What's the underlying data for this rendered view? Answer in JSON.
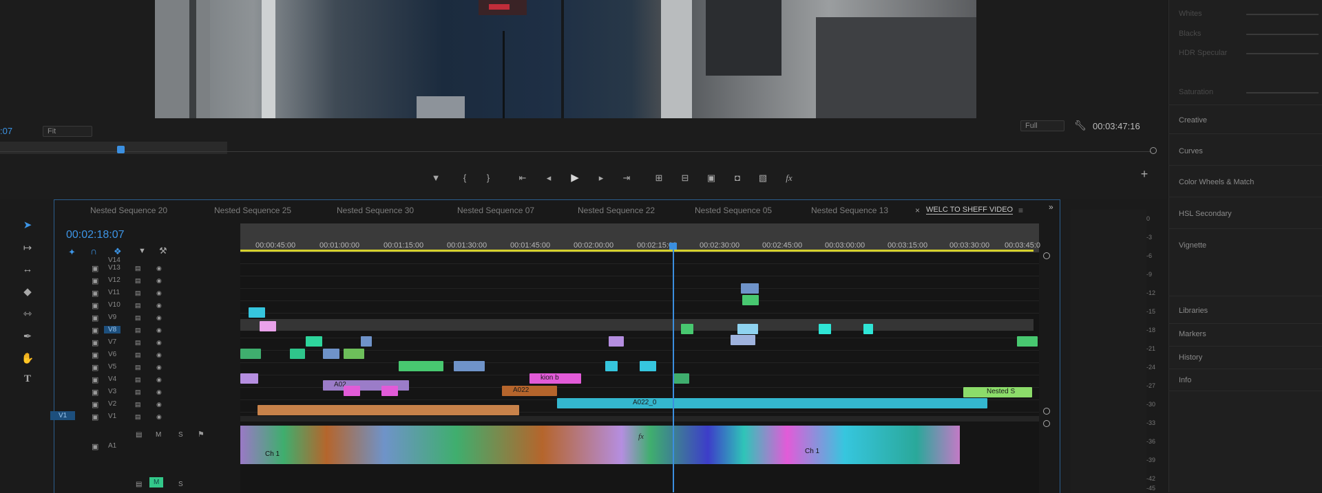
{
  "monitor": {
    "timecode_left": ":07",
    "fit_label": "Fit",
    "quality_label": "Full",
    "duration": "00:03:47:16"
  },
  "transport": {
    "icons": [
      "marker-icon",
      "in-point-icon",
      "out-point-icon",
      "go-to-in-icon",
      "step-back-icon",
      "play-icon",
      "step-forward-icon",
      "go-to-out-icon",
      "insert-icon",
      "overwrite-icon",
      "lift-icon",
      "camera-icon",
      "compare-icon",
      "fx-icon"
    ],
    "fx_label": "fx",
    "add_label": "+"
  },
  "timeline": {
    "timecode": "00:02:18:07",
    "tabs": [
      {
        "label": "Nested Sequence 20"
      },
      {
        "label": "Nested Sequence 25"
      },
      {
        "label": "Nested Sequence 30"
      },
      {
        "label": "Nested Sequence 07"
      },
      {
        "label": "Nested Sequence 22"
      },
      {
        "label": "Nested Sequence 05"
      },
      {
        "label": "Nested Sequence 13"
      },
      {
        "label": "WELC TO SHEFF VIDEO",
        "active": true
      }
    ],
    "close_label": "×",
    "menu_label": "≡",
    "overflow_label": "»",
    "ruler_ticks": [
      "00:00:45:00",
      "00:01:00:00",
      "00:01:15:00",
      "00:01:30:00",
      "00:01:45:00",
      "00:02:00:00",
      "00:02:15:00",
      "00:02:30:00",
      "00:02:45:00",
      "00:03:00:00",
      "00:03:15:00",
      "00:03:30:00",
      "00:03:45:0"
    ],
    "video_tracks": [
      "V14",
      "V13",
      "V12",
      "V11",
      "V10",
      "V9",
      "V8",
      "V7",
      "V6",
      "V5",
      "V4",
      "V3",
      "V2",
      "V1"
    ],
    "v1_source": "V1",
    "audio_tracks": [
      "A1"
    ],
    "audio_controls": {
      "mute": "M",
      "solo": "S"
    },
    "clip_labels": {
      "kion_b": "kion b",
      "a022": "A022",
      "a022_0": "A022_0",
      "a02": "A02",
      "nested5": "Nested S",
      "ch1": "Ch 1",
      "fx": "fx"
    }
  },
  "right_panel": {
    "items": [
      "Whites",
      "Blacks",
      "HDR Specular",
      "Saturation",
      "Creative",
      "Curves",
      "Color Wheels & Match",
      "HSL Secondary",
      "Vignette",
      "Libraries",
      "Markers",
      "History",
      "Info"
    ]
  },
  "meter_scale": [
    "0",
    "-3",
    "-6",
    "-9",
    "-12",
    "-15",
    "-18",
    "-21",
    "-24",
    "-27",
    "-30",
    "-33",
    "-36",
    "-39",
    "-42",
    "-45"
  ],
  "colors": {
    "accent": "#3d95e6",
    "clip_green": "#3fae6e",
    "clip_teal": "#2fc5b8",
    "clip_blue": "#6f93c9",
    "clip_violet": "#b58ee0",
    "clip_pink": "#e25bd8",
    "clip_orange": "#b5652c",
    "clip_cyan": "#36c6de",
    "ruler_yellow": "#d6d12c"
  }
}
